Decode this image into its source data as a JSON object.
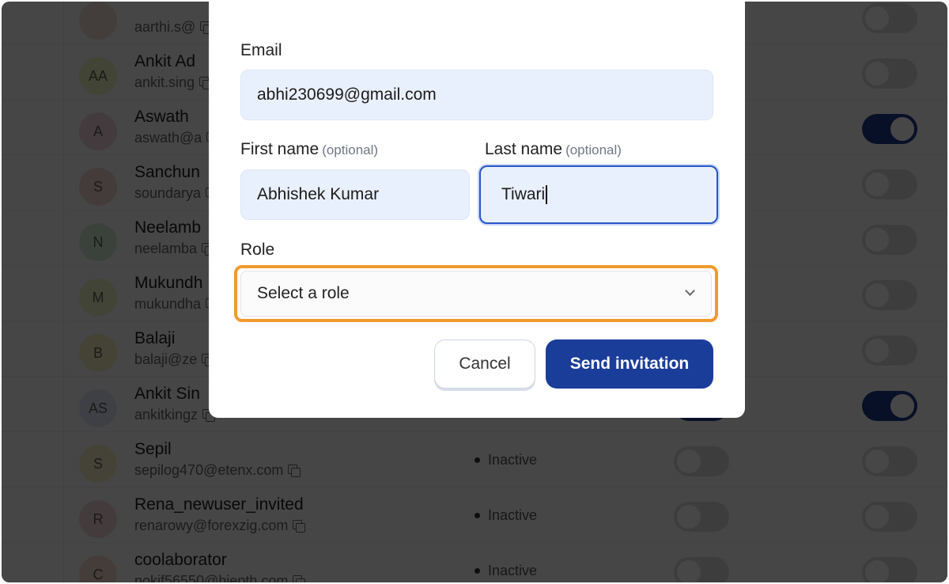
{
  "members": [
    {
      "initials": "",
      "name": "",
      "email": "aarthi.s@",
      "avatar_color": "#f1ddd8",
      "status": "",
      "toggle1": "off",
      "toggle2": "off"
    },
    {
      "initials": "AA",
      "name": "Ankit Ad",
      "email": "ankit.sing",
      "avatar_color": "#eef3c0",
      "status": "",
      "toggle1": "off",
      "toggle2": "off"
    },
    {
      "initials": "A",
      "name": "Aswath",
      "email": "aswath@a",
      "avatar_color": "#f3d5dd",
      "status": "",
      "toggle1": "on",
      "toggle2": "on"
    },
    {
      "initials": "S",
      "name": "Sanchun",
      "email": "soundarya",
      "avatar_color": "#f4d8d0",
      "status": "",
      "toggle1": "off",
      "toggle2": "off"
    },
    {
      "initials": "N",
      "name": "Neelamb",
      "email": "neelamba",
      "avatar_color": "#d4ecd8",
      "status": "",
      "toggle1": "off",
      "toggle2": "off"
    },
    {
      "initials": "M",
      "name": "Mukundh",
      "email": "mukundha",
      "avatar_color": "#f1f2c8",
      "status": "",
      "toggle1": "off",
      "toggle2": "off"
    },
    {
      "initials": "B",
      "name": "Balaji",
      "email": "balaji@ze",
      "avatar_color": "#f3efc2",
      "status": "",
      "toggle1": "off",
      "toggle2": "off"
    },
    {
      "initials": "AS",
      "name": "Ankit Sin",
      "email": "ankitkingz",
      "avatar_color": "#dfe6f7",
      "status": "",
      "toggle1": "on",
      "toggle2": "on"
    },
    {
      "initials": "S",
      "name": "Sepil",
      "email": "sepilog470@etenx.com",
      "avatar_color": "#f6f1c4",
      "status": "Inactive",
      "toggle1": "off",
      "toggle2": "off"
    },
    {
      "initials": "R",
      "name": "Rena_newuser_invited",
      "email": "renarowy@forexzig.com",
      "avatar_color": "#f3d6d6",
      "status": "Inactive",
      "toggle1": "off",
      "toggle2": "off"
    },
    {
      "initials": "C",
      "name": "coolaborator",
      "email": "nokif56550@hiepth.com",
      "avatar_color": "#f6dccd",
      "status": "Inactive",
      "toggle1": "off",
      "toggle2": "off"
    }
  ],
  "modal": {
    "email_label": "Email",
    "email_value": "abhi230699@gmail.com",
    "first_name_label": "First name",
    "last_name_label": "Last name",
    "optional_tag": "(optional)",
    "first_name_value": "Abhishek Kumar",
    "last_name_value": "Tiwari",
    "role_label": "Role",
    "role_placeholder": "Select a role",
    "cancel_label": "Cancel",
    "send_label": "Send invitation"
  },
  "colors": {
    "primary": "#1a3d9a",
    "focus_ring": "#2a55c8",
    "highlight": "#f09a2e"
  }
}
